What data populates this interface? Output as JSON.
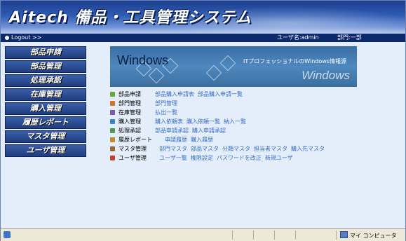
{
  "header": {
    "title": "Aitech 備品・工具管理システム",
    "logout": "Logout >>",
    "user_label": "ユーザ名:admin",
    "dept_label": "部門:一部"
  },
  "sidebar": {
    "items": [
      {
        "label": "部品申請"
      },
      {
        "label": "部品管理"
      },
      {
        "label": "処理承認"
      },
      {
        "label": "在庫管理"
      },
      {
        "label": "購入管理"
      },
      {
        "label": "履歴レポート"
      },
      {
        "label": "マスタ管理"
      },
      {
        "label": "ユーザ管理"
      }
    ]
  },
  "banner": {
    "title": "Windows",
    "subtitle": "ITプロフェッショナルのWindows情報源",
    "wordmark": "Windows"
  },
  "menu": [
    {
      "category": "部品申請",
      "color": "#6aa83a",
      "links": [
        "部品購入申請表",
        "部品購入申請一覧"
      ]
    },
    {
      "category": "部門管理",
      "color": "#d0742c",
      "links": [
        "部門管理"
      ]
    },
    {
      "category": "在庫管理",
      "color": "#7a5cb8",
      "links": [
        "払出一覧"
      ]
    },
    {
      "category": "購入管理",
      "color": "#3c86c6",
      "links": [
        "購入依頼表",
        "購入依頼一覧",
        "納入一覧"
      ]
    },
    {
      "category": "処理承認",
      "color": "#4f9a4f",
      "links": [
        "部品申請承認",
        "購入申請承認"
      ]
    },
    {
      "category": "履歴レポート",
      "color": "#c28a2a",
      "links": [
        "申請履歴",
        "購入履歴"
      ]
    },
    {
      "category": "マスタ管理",
      "color": "#8a6a3a",
      "links": [
        "部門マスタ",
        "部品マスタ",
        "分類マスタ",
        "担当者マスタ",
        "購入先マスタ"
      ]
    },
    {
      "category": "ユーザ管理",
      "color": "#c8402a",
      "links": [
        "ユーザ一覧",
        "権限設定",
        "パスワードを改正",
        "新規ユーザ"
      ]
    }
  ],
  "statusbar": {
    "zone": "マイ コンピュータ"
  }
}
